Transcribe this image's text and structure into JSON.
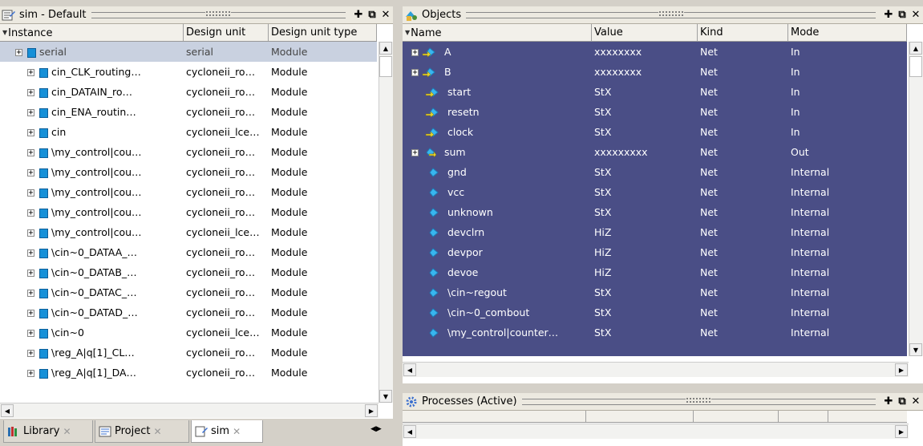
{
  "sim_pane": {
    "title": "sim - Default",
    "columns": [
      "Instance",
      "Design unit",
      "Design unit type"
    ],
    "rows": [
      {
        "instance": "serial",
        "unit": "serial",
        "type": "Module",
        "selected": true,
        "root": true
      },
      {
        "instance": "cin_CLK_routing…",
        "unit": "cycloneii_ro…",
        "type": "Module"
      },
      {
        "instance": "cin_DATAIN_ro…",
        "unit": "cycloneii_ro…",
        "type": "Module"
      },
      {
        "instance": "cin_ENA_routin…",
        "unit": "cycloneii_ro…",
        "type": "Module"
      },
      {
        "instance": "cin",
        "unit": "cycloneii_lce…",
        "type": "Module"
      },
      {
        "instance": "\\my_control|cou…",
        "unit": "cycloneii_ro…",
        "type": "Module"
      },
      {
        "instance": "\\my_control|cou…",
        "unit": "cycloneii_ro…",
        "type": "Module"
      },
      {
        "instance": "\\my_control|cou…",
        "unit": "cycloneii_ro…",
        "type": "Module"
      },
      {
        "instance": "\\my_control|cou…",
        "unit": "cycloneii_ro…",
        "type": "Module"
      },
      {
        "instance": "\\my_control|cou…",
        "unit": "cycloneii_lce…",
        "type": "Module"
      },
      {
        "instance": "\\cin~0_DATAA_…",
        "unit": "cycloneii_ro…",
        "type": "Module"
      },
      {
        "instance": "\\cin~0_DATAB_…",
        "unit": "cycloneii_ro…",
        "type": "Module"
      },
      {
        "instance": "\\cin~0_DATAC_…",
        "unit": "cycloneii_ro…",
        "type": "Module"
      },
      {
        "instance": "\\cin~0_DATAD_…",
        "unit": "cycloneii_ro…",
        "type": "Module"
      },
      {
        "instance": "\\cin~0",
        "unit": "cycloneii_lce…",
        "type": "Module"
      },
      {
        "instance": "\\reg_A|q[1]_CL…",
        "unit": "cycloneii_ro…",
        "type": "Module"
      },
      {
        "instance": "\\reg_A|q[1]_DA…",
        "unit": "cycloneii_ro…",
        "type": "Module"
      }
    ]
  },
  "objects_pane": {
    "title": "Objects",
    "columns": [
      "Name",
      "Value",
      "Kind",
      "Mode"
    ],
    "rows": [
      {
        "name": "A",
        "value": "xxxxxxxx",
        "kind": "Net",
        "mode": "In",
        "expandable": true,
        "dir": "in"
      },
      {
        "name": "B",
        "value": "xxxxxxxx",
        "kind": "Net",
        "mode": "In",
        "expandable": true,
        "dir": "in"
      },
      {
        "name": "start",
        "value": "StX",
        "kind": "Net",
        "mode": "In",
        "dir": "in"
      },
      {
        "name": "resetn",
        "value": "StX",
        "kind": "Net",
        "mode": "In",
        "dir": "in"
      },
      {
        "name": "clock",
        "value": "StX",
        "kind": "Net",
        "mode": "In",
        "dir": "in"
      },
      {
        "name": "sum",
        "value": "xxxxxxxxx",
        "kind": "Net",
        "mode": "Out",
        "expandable": true,
        "dir": "out"
      },
      {
        "name": "gnd",
        "value": "StX",
        "kind": "Net",
        "mode": "Internal",
        "dir": "int"
      },
      {
        "name": "vcc",
        "value": "StX",
        "kind": "Net",
        "mode": "Internal",
        "dir": "int"
      },
      {
        "name": "unknown",
        "value": "StX",
        "kind": "Net",
        "mode": "Internal",
        "dir": "int"
      },
      {
        "name": "devclrn",
        "value": "HiZ",
        "kind": "Net",
        "mode": "Internal",
        "dir": "int"
      },
      {
        "name": "devpor",
        "value": "HiZ",
        "kind": "Net",
        "mode": "Internal",
        "dir": "int"
      },
      {
        "name": "devoe",
        "value": "HiZ",
        "kind": "Net",
        "mode": "Internal",
        "dir": "int"
      },
      {
        "name": "\\cin~regout",
        "value": "StX",
        "kind": "Net",
        "mode": "Internal",
        "dir": "int"
      },
      {
        "name": "\\cin~0_combout",
        "value": "StX",
        "kind": "Net",
        "mode": "Internal",
        "dir": "int"
      },
      {
        "name": "\\my_control|counter…",
        "value": "StX",
        "kind": "Net",
        "mode": "Internal",
        "dir": "int"
      }
    ]
  },
  "processes_pane": {
    "title": "Processes (Active)"
  },
  "tabs": [
    {
      "label": "Library",
      "icon": "library-icon"
    },
    {
      "label": "Project",
      "icon": "project-icon"
    },
    {
      "label": "sim",
      "icon": "sim-icon",
      "active": true
    }
  ],
  "colors": {
    "objects_bg": "#4a4e86",
    "selection": "#c9d1e0",
    "module_icon": "#1690d8"
  }
}
